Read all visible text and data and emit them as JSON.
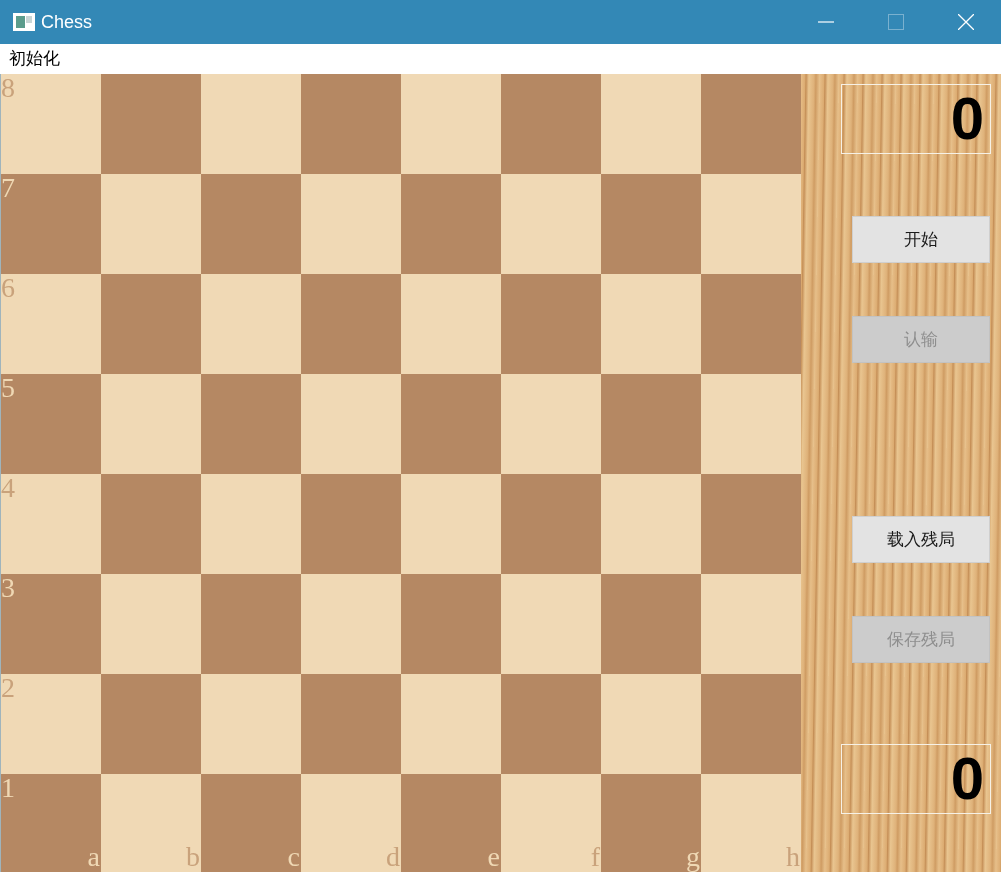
{
  "window": {
    "title": "Chess",
    "controls": [
      {
        "kind": "minimize",
        "disabled": false
      },
      {
        "kind": "maximize",
        "disabled": true
      },
      {
        "kind": "close",
        "disabled": false
      }
    ]
  },
  "menu_bar": [
    {
      "label": "初始化"
    }
  ],
  "board": {
    "ranks": [
      "8",
      "7",
      "6",
      "5",
      "4",
      "3",
      "2",
      "1"
    ],
    "files": [
      "a",
      "b",
      "c",
      "d",
      "e",
      "f",
      "g",
      "h"
    ]
  },
  "side_panel": {
    "top_counter": "0",
    "game_buttons": [
      {
        "label": "开始",
        "disabled": false
      },
      {
        "label": "认输",
        "disabled": true
      }
    ],
    "endgame_buttons": [
      {
        "label": "载入残局",
        "disabled": false
      },
      {
        "label": "保存残局",
        "disabled": true
      }
    ],
    "bottom_counter": "0"
  }
}
